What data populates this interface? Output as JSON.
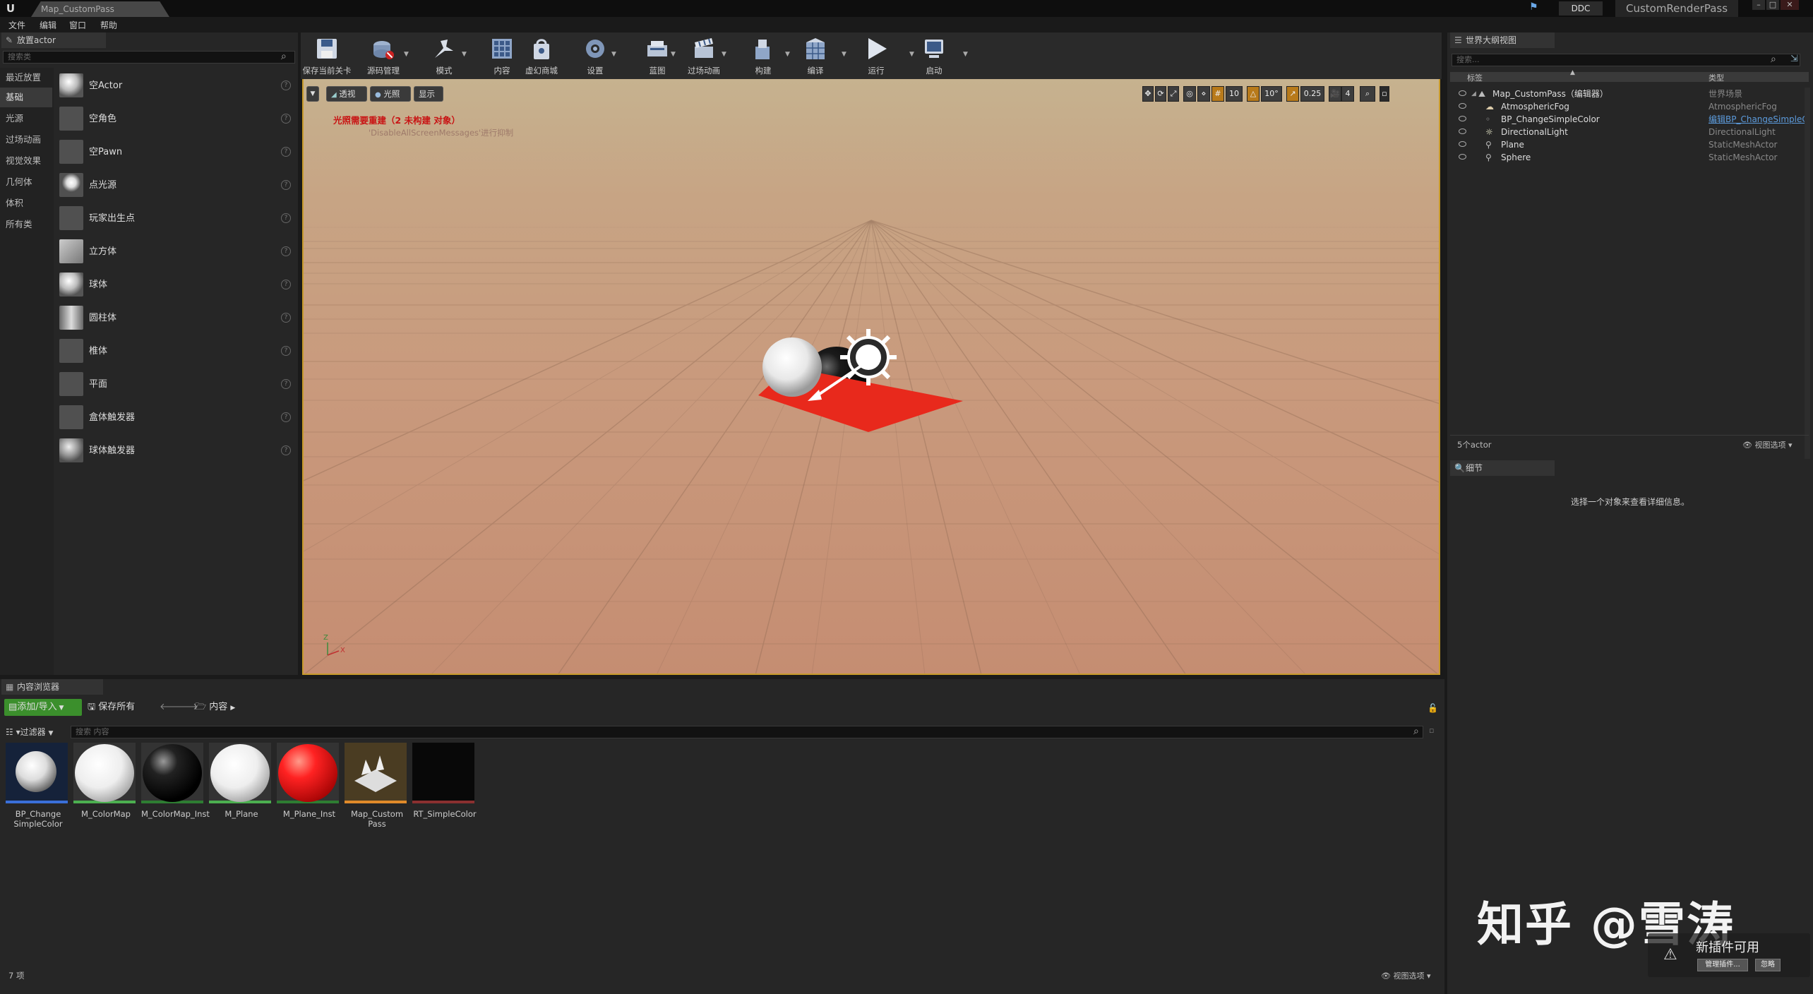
{
  "titlebar": {
    "document_tab": "Map_CustomPass",
    "ddc_label": "DDC",
    "project_name": "CustomRenderPass"
  },
  "menubar": [
    "文件",
    "编辑",
    "窗口",
    "帮助"
  ],
  "place_actors": {
    "tab_title": "放置actor",
    "search_placeholder": "搜索类",
    "categories": [
      "最近放置",
      "基础",
      "光源",
      "过场动画",
      "视觉效果",
      "几何体",
      "体积",
      "所有类"
    ],
    "selected_category": "基础",
    "items": [
      "空Actor",
      "空角色",
      "空Pawn",
      "点光源",
      "玩家出生点",
      "立方体",
      "球体",
      "圆柱体",
      "椎体",
      "平面",
      "盒体触发器",
      "球体触发器"
    ]
  },
  "toolbar": {
    "buttons": [
      "保存当前关卡",
      "源码管理",
      "模式",
      "内容",
      "虚幻商城",
      "设置",
      "蓝图",
      "过场动画",
      "构建",
      "编译",
      "运行",
      "启动"
    ]
  },
  "viewport": {
    "perspective_label": "透视",
    "lit_label": "光照",
    "show_label": "显示",
    "grid_snap": "10",
    "rotation_snap": "10°",
    "scale_snap": "0.25",
    "camera_speed": "4",
    "warning": "光照需要重建（2 未构建 对象）",
    "warning_sub": "'DisableAllScreenMessages'进行抑制",
    "axis_z": "Z",
    "axis_x": "X"
  },
  "outliner": {
    "tab_title": "世界大纲视图",
    "search_placeholder": "搜索...",
    "col_label": "标签",
    "col_type": "类型",
    "rows": [
      {
        "name": "Map_CustomPass（编辑器）",
        "type": "世界场景"
      },
      {
        "name": "AtmosphericFog",
        "type": "AtmosphericFog"
      },
      {
        "name": "BP_ChangeSimpleColor",
        "type": "编辑BP_ChangeSimpleC"
      },
      {
        "name": "DirectionalLight",
        "type": "DirectionalLight"
      },
      {
        "name": "Plane",
        "type": "StaticMeshActor"
      },
      {
        "name": "Sphere",
        "type": "StaticMeshActor"
      }
    ],
    "count": "5个actor",
    "view_options": "视图选项"
  },
  "details": {
    "tab_title": "细节",
    "empty_message": "选择一个对象来查看详细信息。"
  },
  "content_browser": {
    "tab_title": "内容浏览器",
    "add_import": "添加/导入",
    "save_all": "保存所有",
    "path_root": "内容",
    "filters": "过滤器",
    "search_placeholder": "搜索 内容",
    "assets": [
      {
        "name": "BP_Change SimpleColor",
        "color": "#3a6fd8"
      },
      {
        "name": "M_ColorMap",
        "color": "#4caf50"
      },
      {
        "name": "M_ColorMap_Inst",
        "color": "#2e7d32"
      },
      {
        "name": "M_Plane",
        "color": "#4caf50"
      },
      {
        "name": "M_Plane_Inst",
        "color": "#2e7d32"
      },
      {
        "name": "Map_Custom Pass",
        "color": "#e08a2a"
      },
      {
        "name": "RT_SimpleColor",
        "color": "#8a3030"
      }
    ],
    "item_count": "7 项",
    "view_options": "视图选项"
  },
  "notification": {
    "title": "新插件可用",
    "manage_button": "管理插件...",
    "dismiss_button": "忽略"
  },
  "watermark": "知乎 @雪涛"
}
